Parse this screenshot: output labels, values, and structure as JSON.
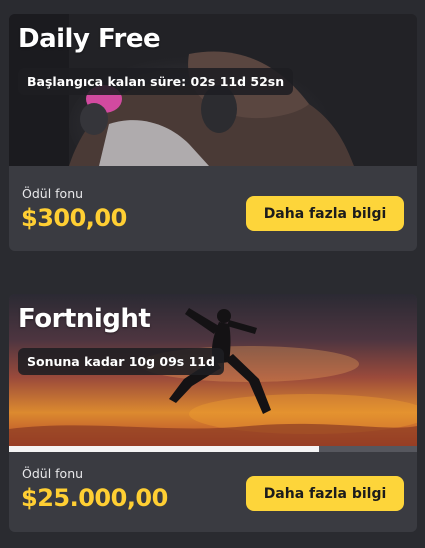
{
  "cards": [
    {
      "title": "Daily Free",
      "timer": "Başlangıca kalan süre: 02s 11d 52sn",
      "prize_label": "Ödül fonu",
      "prize_value": "$300,00",
      "button_label": "Daha fazla bilgi"
    },
    {
      "title": "Fortnight",
      "timer": "Sonuna kadar 10g 09s 11d",
      "prize_label": "Ödül fonu",
      "prize_value": "$25.000,00",
      "button_label": "Daha fazla bilgi",
      "progress": 0.76
    }
  ],
  "colors": {
    "page_bg": "#2a2b30",
    "card_bg": "#3a3b41",
    "accent_yellow": "#ffcf33",
    "button_bg": "#fdd53a",
    "progress_fill": "#f4f4f4"
  }
}
